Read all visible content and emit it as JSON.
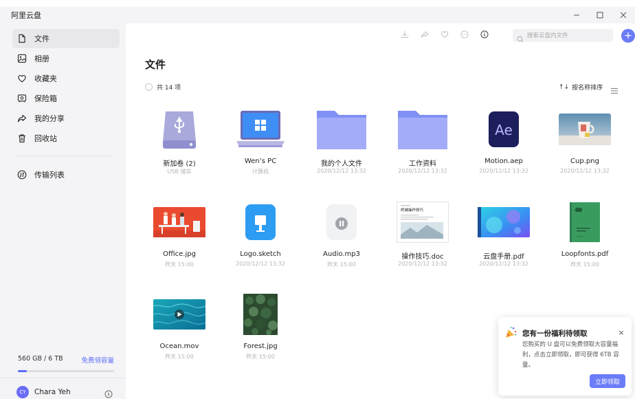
{
  "window": {
    "title": "阿里云盘",
    "controls": [
      "minimize-icon",
      "maximize-icon",
      "close-icon"
    ]
  },
  "sidebar": {
    "items": [
      {
        "label": "文件",
        "icon": "file-icon",
        "active": true
      },
      {
        "label": "相册",
        "icon": "photo-icon",
        "active": false
      },
      {
        "label": "收藏夹",
        "icon": "heart-icon",
        "active": false
      },
      {
        "label": "保险箱",
        "icon": "safe-icon",
        "active": false
      },
      {
        "label": "我的分享",
        "icon": "share-icon",
        "active": false
      },
      {
        "label": "回收站",
        "icon": "trash-icon",
        "active": false
      }
    ],
    "transfer": {
      "label": "传输列表",
      "icon": "transfer-icon"
    },
    "storage": {
      "used": "560 GB / 6 TB",
      "free_link": "免费领容量",
      "used_fraction": 0.09
    },
    "user": {
      "initials": "CY",
      "name": "Chara Yeh"
    }
  },
  "toolbar": {
    "icons": [
      "download-icon",
      "share-icon",
      "favorite-icon",
      "more-icon",
      "info-icon"
    ],
    "search_placeholder": "搜索云盘内文件",
    "add_label": "+"
  },
  "main": {
    "title": "文件",
    "count": "共 14 项",
    "sort_label": "按名称排序",
    "sort_arrow": "↑↓"
  },
  "files": [
    {
      "name": "新加卷 (2)",
      "meta": "USB 储存",
      "kind": "usb"
    },
    {
      "name": "Wen’s PC",
      "meta": "计算机",
      "kind": "pc"
    },
    {
      "name": "我的个人文件",
      "meta": "2020/12/12 13:32",
      "kind": "folder"
    },
    {
      "name": "工作资料",
      "meta": "2020/12/12 13:32",
      "kind": "folder"
    },
    {
      "name": "Motion.aep",
      "meta": "2020/12/12 13:32",
      "kind": "ae",
      "badge": "Ae"
    },
    {
      "name": "Cup.png",
      "meta": "2020/12/12 13:32",
      "kind": "cup"
    },
    {
      "name": "Office.jpg",
      "meta": "昨天 15:00",
      "kind": "office"
    },
    {
      "name": "Logo.sketch",
      "meta": "2020/12/12 13:32",
      "kind": "sketch"
    },
    {
      "name": "Audio.mp3",
      "meta": "昨天 15:00",
      "kind": "audio"
    },
    {
      "name": "操作技巧.doc",
      "meta": "2020/12/12 13:32",
      "kind": "doc",
      "doc_heading": "终端操作技巧"
    },
    {
      "name": "云盘手册.pdf",
      "meta": "2020/12/12 13:32",
      "kind": "pdf"
    },
    {
      "name": "Loopfonts.pdf",
      "meta": "昨天 15:00",
      "kind": "book"
    },
    {
      "name": "Ocean.mov",
      "meta": "昨天 15:00",
      "kind": "ocean"
    },
    {
      "name": "Forest.jpg",
      "meta": "昨天 15:00",
      "kind": "forest"
    }
  ],
  "toast": {
    "title": "您有一份福利待领取",
    "body": "您购买的 U 盘可以免费领取大容量福利，点击立即领取，即可获得 6TB 容量。",
    "button": "立即领取",
    "close": "×"
  },
  "colors": {
    "accent": "#6b7cf7",
    "sidebar_bg": "#f4f4f6",
    "folder": "#8a97f7"
  }
}
